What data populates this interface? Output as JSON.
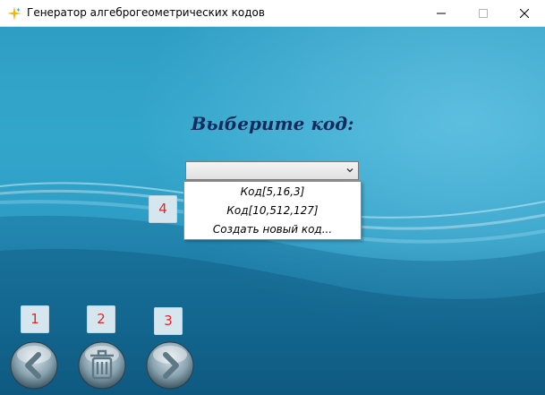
{
  "window": {
    "title": "Генератор алгеброгеометрических кодов",
    "icon": "sparkle-icon",
    "controls": [
      "minimize-icon",
      "maximize-icon",
      "close-icon"
    ]
  },
  "main": {
    "heading": "Выберите код:",
    "code_select": {
      "selected_value": "",
      "options": [
        "Код[5,16,3]",
        "Код[10,512,127]",
        "Создать новый код..."
      ]
    },
    "badges": {
      "one": "1",
      "two": "2",
      "three": "3",
      "four": "4"
    },
    "buttons": {
      "back_icon": "arrow-left-icon",
      "delete_icon": "trash-icon",
      "forward_icon": "arrow-right-icon"
    }
  },
  "colors": {
    "heading": "#152a5c",
    "badge_text": "#e0262a",
    "background": "#2f9ec4"
  }
}
